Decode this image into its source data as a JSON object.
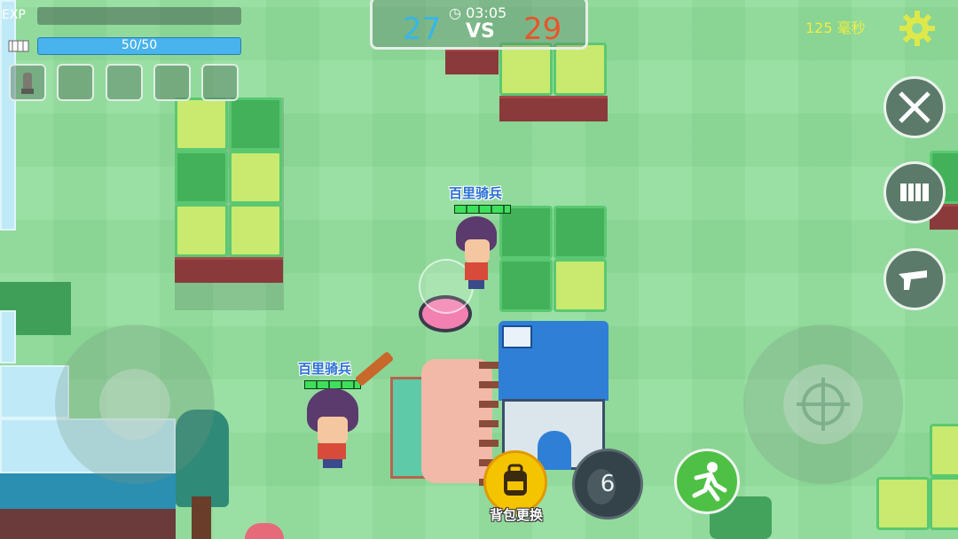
{
  "hud": {
    "exp_label": "EXP",
    "health_text": "50/50",
    "ping_text": "125 毫秒",
    "settings_icon": "gear-icon"
  },
  "score": {
    "timer": "03:05",
    "blue": "27",
    "vs": "VS",
    "red": "29",
    "blue_color": "#37b6e8",
    "red_color": "#e8552c"
  },
  "inventory": {
    "slots": [
      "grenade-item",
      "",
      "",
      "",
      ""
    ]
  },
  "players": [
    {
      "name": "百里骑兵"
    },
    {
      "name": "百里骑兵"
    }
  ],
  "actions": {
    "backpack_label": "背包更换",
    "grenade_count": "6"
  },
  "colors": {
    "grass": "#8fdc9a",
    "block_dark": "#43b15a",
    "block_light": "#c9ea6e",
    "dirt": "#8a3a3a",
    "house_roof": "#2f7fd6",
    "backpack": "#f5c400"
  }
}
